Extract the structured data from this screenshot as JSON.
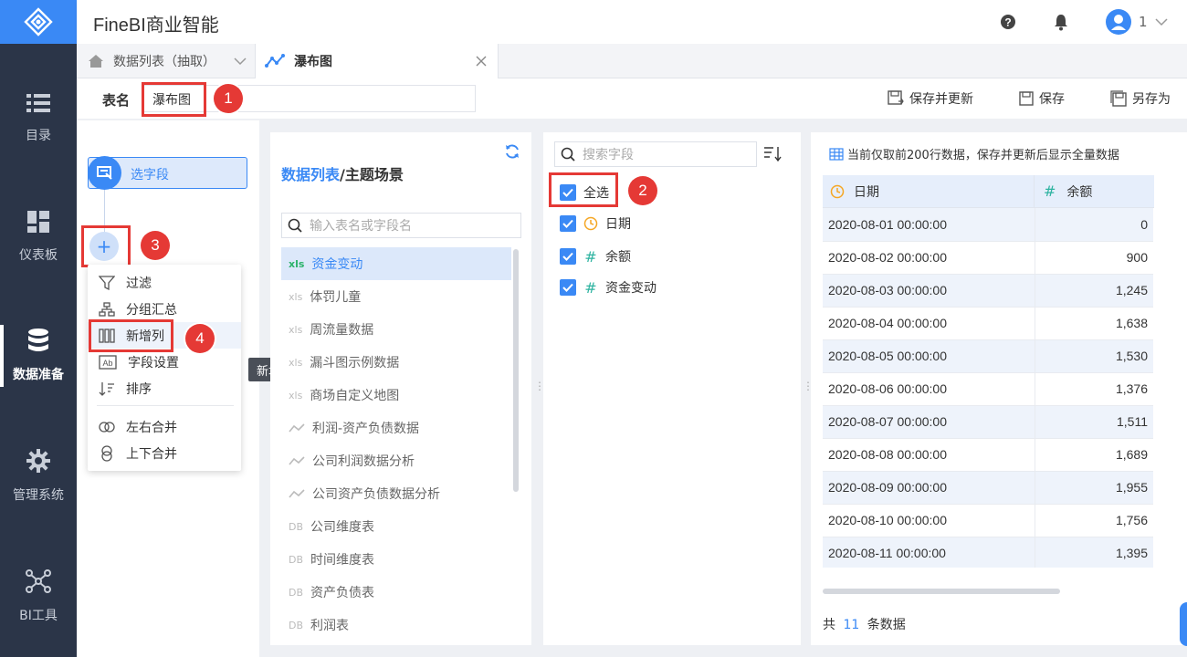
{
  "app": {
    "title": "FineBI商业智能",
    "user_label": "1"
  },
  "nav": {
    "items": [
      {
        "label": "目录",
        "icon": "list-icon"
      },
      {
        "label": "仪表板",
        "icon": "dashboard-icon"
      },
      {
        "label": "数据准备",
        "icon": "database-icon",
        "active": true
      },
      {
        "label": "管理系统",
        "icon": "gear-icon"
      },
      {
        "label": "BI工具",
        "icon": "tools-icon"
      }
    ]
  },
  "tabs": [
    {
      "label": "数据列表（抽取）",
      "icon": "home-icon"
    },
    {
      "label": "瀑布图",
      "icon": "chart-icon",
      "active": true
    }
  ],
  "namebar": {
    "label": "表名",
    "value": "瀑布图",
    "save_update": "保存并更新",
    "save": "保存",
    "save_as": "另存为"
  },
  "flow": {
    "step1": "选字段",
    "tooltip": "新增列"
  },
  "menu": {
    "items": [
      "过滤",
      "分组汇总",
      "新增列",
      "字段设置",
      "排序",
      "左右合并",
      "上下合并"
    ]
  },
  "datasource": {
    "title_a": "数据列表",
    "title_b": "/主题场景",
    "search_placeholder": "输入表名或字段名",
    "items": [
      {
        "label": "资金变动",
        "type": "xls"
      },
      {
        "label": "体罚儿童",
        "type": "xls"
      },
      {
        "label": "周流量数据",
        "type": "xls"
      },
      {
        "label": "漏斗图示例数据",
        "type": "xls"
      },
      {
        "label": "商场自定义地图",
        "type": "xls"
      },
      {
        "label": "利润-资产负债数据",
        "type": "chart"
      },
      {
        "label": "公司利润数据分析",
        "type": "chart"
      },
      {
        "label": "公司资产负债数据分析",
        "type": "chart"
      },
      {
        "label": "公司维度表",
        "type": "db"
      },
      {
        "label": "时间维度表",
        "type": "db"
      },
      {
        "label": "资产负债表",
        "type": "db"
      },
      {
        "label": "利润表",
        "type": "db"
      }
    ]
  },
  "fields": {
    "search_placeholder": "搜索字段",
    "select_all": "全选",
    "items": [
      {
        "label": "日期",
        "type": "date"
      },
      {
        "label": "余额",
        "type": "number"
      },
      {
        "label": "资金变动",
        "type": "number"
      }
    ]
  },
  "preview": {
    "notice": "当前仅取前200行数据，保存并更新后显示全量数据",
    "columns": [
      "日期",
      "余额"
    ],
    "rows": [
      [
        "2020-08-01 00:00:00",
        "0"
      ],
      [
        "2020-08-02 00:00:00",
        "900"
      ],
      [
        "2020-08-03 00:00:00",
        "1,245"
      ],
      [
        "2020-08-04 00:00:00",
        "1,638"
      ],
      [
        "2020-08-05 00:00:00",
        "1,530"
      ],
      [
        "2020-08-06 00:00:00",
        "1,376"
      ],
      [
        "2020-08-07 00:00:00",
        "1,511"
      ],
      [
        "2020-08-08 00:00:00",
        "1,689"
      ],
      [
        "2020-08-09 00:00:00",
        "1,955"
      ],
      [
        "2020-08-10 00:00:00",
        "1,756"
      ],
      [
        "2020-08-11 00:00:00",
        "1,395"
      ]
    ],
    "footer_pre": "共",
    "footer_count": "11",
    "footer_post": "条数据"
  },
  "annotations": [
    "1",
    "2",
    "3",
    "4"
  ],
  "colors": {
    "accent": "#3a89f5",
    "rail": "#2b3548",
    "highlight": "#e53935"
  }
}
